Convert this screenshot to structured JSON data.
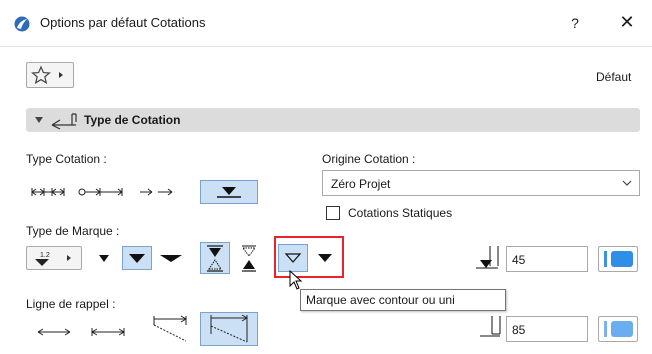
{
  "window": {
    "title": "Options par défaut Cotations",
    "help_label": "?",
    "close_label": "✕"
  },
  "toolbar": {
    "favorites_icon": "star-icon",
    "default_label": "Défaut"
  },
  "section": {
    "title": "Type de Cotation",
    "icon": "dimension-icon"
  },
  "type_cotation": {
    "label": "Type Cotation :",
    "options": [
      "linear-dimension",
      "elevation-dimension",
      "cumulative-dimension",
      "level-marker"
    ],
    "selected_index": 3
  },
  "origine": {
    "label": "Origine Cotation :",
    "value": "Zéro Projet",
    "static_label": "Cotations Statiques",
    "static_checked": false
  },
  "type_marque": {
    "label": "Type de Marque :",
    "marker_size": "45",
    "tooltip": "Marque avec contour ou uni"
  },
  "ligne_rappel": {
    "label": "Ligne de rappel :",
    "length": "85"
  },
  "colors": {
    "selection_bg": "#cce0f5",
    "selection_border": "#7da2ce",
    "highlight": "#e8232a",
    "pen_blue": "#2f8ee6"
  }
}
